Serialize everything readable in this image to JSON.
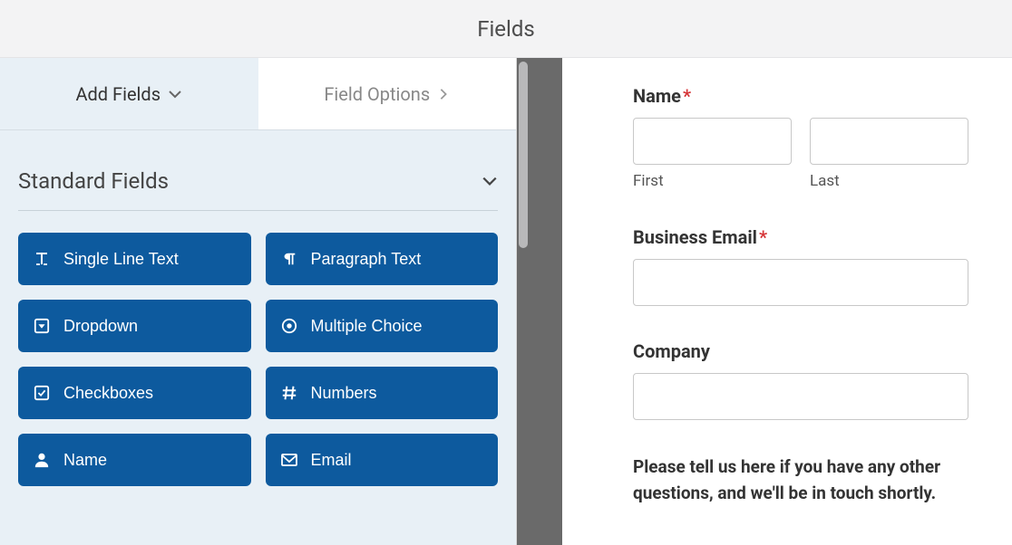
{
  "header": {
    "title": "Fields"
  },
  "tabs": {
    "add_fields": "Add Fields",
    "field_options": "Field Options"
  },
  "section": {
    "standard": "Standard Fields"
  },
  "fields": [
    {
      "icon": "text-cursor",
      "label": "Single Line Text"
    },
    {
      "icon": "paragraph",
      "label": "Paragraph Text"
    },
    {
      "icon": "caret-square-down",
      "label": "Dropdown"
    },
    {
      "icon": "bullseye",
      "label": "Multiple Choice"
    },
    {
      "icon": "check-square",
      "label": "Checkboxes"
    },
    {
      "icon": "hashtag",
      "label": "Numbers"
    },
    {
      "icon": "user",
      "label": "Name"
    },
    {
      "icon": "envelope",
      "label": "Email"
    }
  ],
  "form": {
    "name_label": "Name",
    "first": "First",
    "last": "Last",
    "email_label": "Business Email",
    "company_label": "Company",
    "prompt": "Please tell us here if you have any other questions, and we'll be in touch shortly."
  }
}
